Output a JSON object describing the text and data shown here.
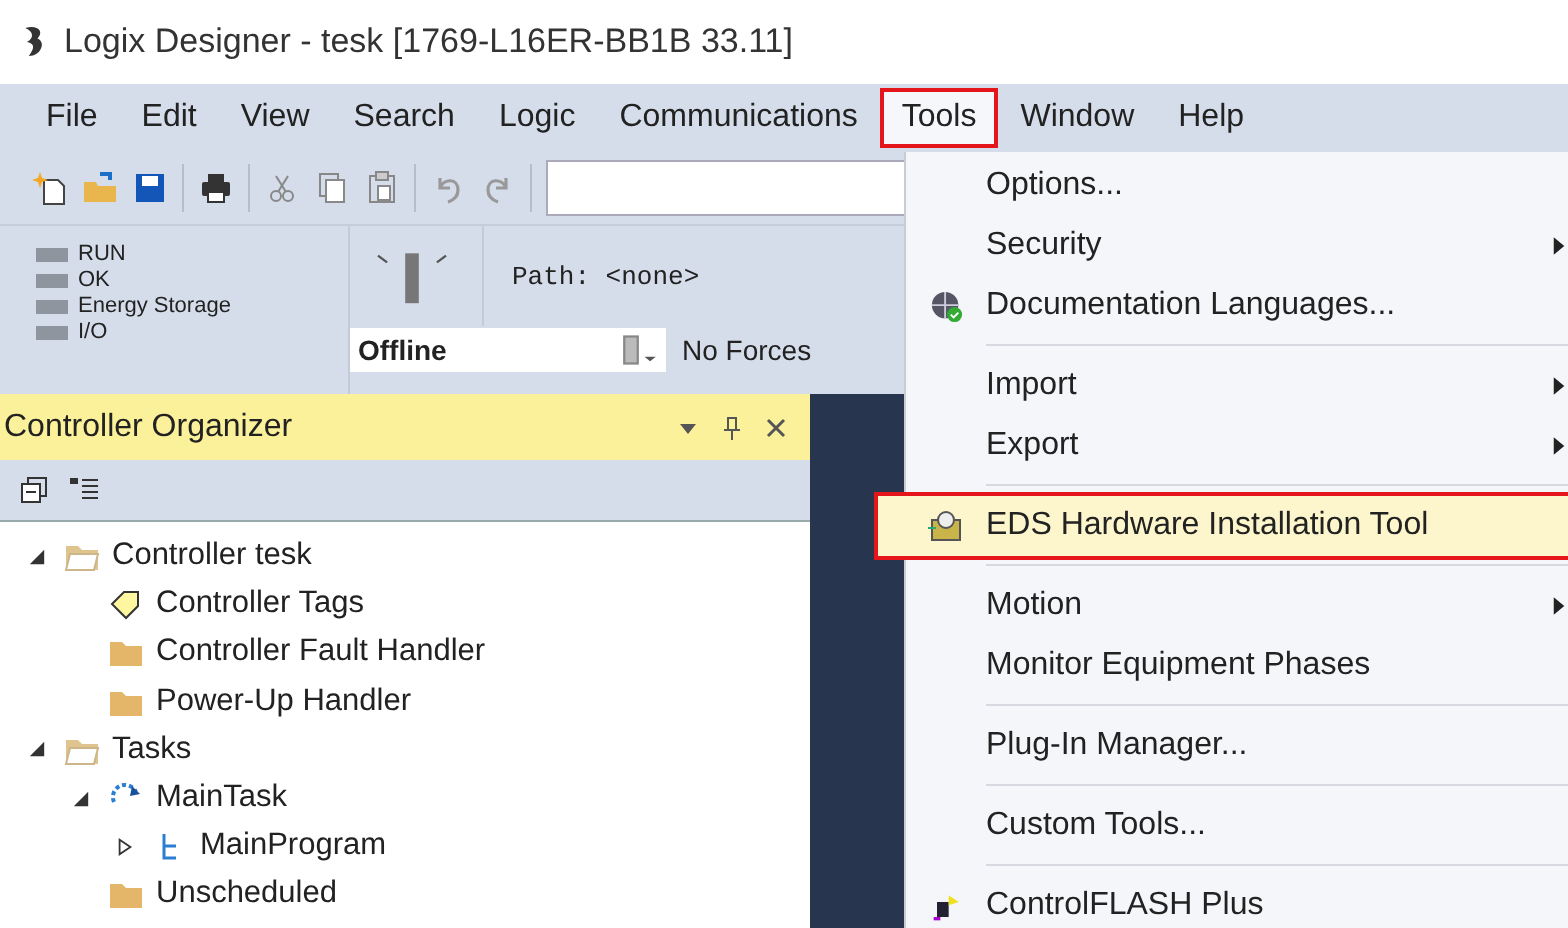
{
  "window": {
    "title": "Logix Designer - tesk [1769-L16ER-BB1B 33.11]"
  },
  "menu_bar": [
    {
      "label": "File",
      "selected": false
    },
    {
      "label": "Edit",
      "selected": false
    },
    {
      "label": "View",
      "selected": false
    },
    {
      "label": "Search",
      "selected": false
    },
    {
      "label": "Logic",
      "selected": false
    },
    {
      "label": "Communications",
      "selected": false
    },
    {
      "label": "Tools",
      "selected": true
    },
    {
      "label": "Window",
      "selected": false
    },
    {
      "label": "Help",
      "selected": false
    }
  ],
  "status": {
    "lights": [
      "RUN",
      "OK",
      "Energy Storage",
      "I/O"
    ],
    "path": "Path: <none>",
    "mode": "Offline",
    "forces": "No Forces"
  },
  "organizer": {
    "title": "Controller Organizer",
    "tree": [
      {
        "label": "Controller tesk",
        "kind": "folder-open",
        "expanded": true,
        "children": [
          {
            "label": "Controller Tags",
            "kind": "tag"
          },
          {
            "label": "Controller Fault Handler",
            "kind": "folder"
          },
          {
            "label": "Power-Up Handler",
            "kind": "folder"
          }
        ]
      },
      {
        "label": "Tasks",
        "kind": "folder-open",
        "expanded": true,
        "children": [
          {
            "label": "MainTask",
            "kind": "task",
            "expanded": true,
            "children": [
              {
                "label": "MainProgram",
                "kind": "program",
                "expanded": false
              }
            ]
          },
          {
            "label": "Unscheduled",
            "kind": "folder"
          }
        ]
      }
    ]
  },
  "tools_menu": [
    {
      "kind": "item",
      "label": "Options...",
      "submenu": false,
      "highlighted": false
    },
    {
      "kind": "item",
      "label": "Security",
      "submenu": true,
      "highlighted": false
    },
    {
      "kind": "item",
      "label": "Documentation Languages...",
      "submenu": false,
      "highlighted": false
    },
    {
      "kind": "separator"
    },
    {
      "kind": "item",
      "label": "Import",
      "submenu": true,
      "highlighted": false
    },
    {
      "kind": "item",
      "label": "Export",
      "submenu": true,
      "highlighted": false
    },
    {
      "kind": "separator"
    },
    {
      "kind": "item",
      "label": "EDS Hardware Installation Tool",
      "submenu": false,
      "highlighted": true
    },
    {
      "kind": "separator"
    },
    {
      "kind": "item",
      "label": "Motion",
      "submenu": true,
      "highlighted": false
    },
    {
      "kind": "item",
      "label": "Monitor Equipment Phases",
      "submenu": false,
      "highlighted": false
    },
    {
      "kind": "separator"
    },
    {
      "kind": "item",
      "label": "Plug-In Manager...",
      "submenu": false,
      "highlighted": false
    },
    {
      "kind": "separator"
    },
    {
      "kind": "item",
      "label": "Custom Tools...",
      "submenu": false,
      "highlighted": false
    },
    {
      "kind": "separator"
    },
    {
      "kind": "item",
      "label": "ControlFLASH Plus",
      "submenu": false,
      "highlighted": false
    }
  ]
}
